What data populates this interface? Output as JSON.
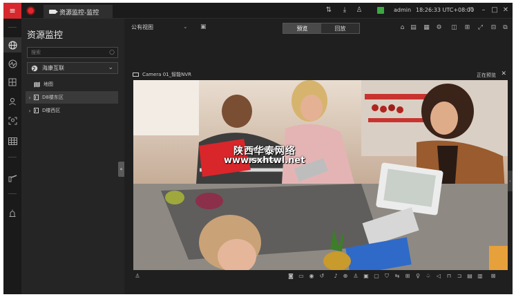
{
  "titlebar": {
    "tab_label": "资源监控-监控",
    "user": "admin",
    "time": "18:26:33 UTC+08:00"
  },
  "panel": {
    "title": "资源监控",
    "search_placeholder": "搜索",
    "site_selector": "海康互联",
    "tree": [
      {
        "label": "地图"
      },
      {
        "label": "D8楼东区"
      },
      {
        "label": "D楼西区"
      }
    ]
  },
  "main": {
    "view_select": "公有视图",
    "seg_preview": "预览",
    "seg_playback": "回放",
    "camera_title": "Camera 01_智能NVR",
    "camera_status": "正在预览",
    "watermark_line1": "陕西华泰网络",
    "watermark_line2": "www.sxhtwl.net"
  },
  "colors": {
    "accent": "#d6282d",
    "status_green": "#3aa843",
    "panel_bg": "#252525",
    "app_bg": "#212121"
  }
}
